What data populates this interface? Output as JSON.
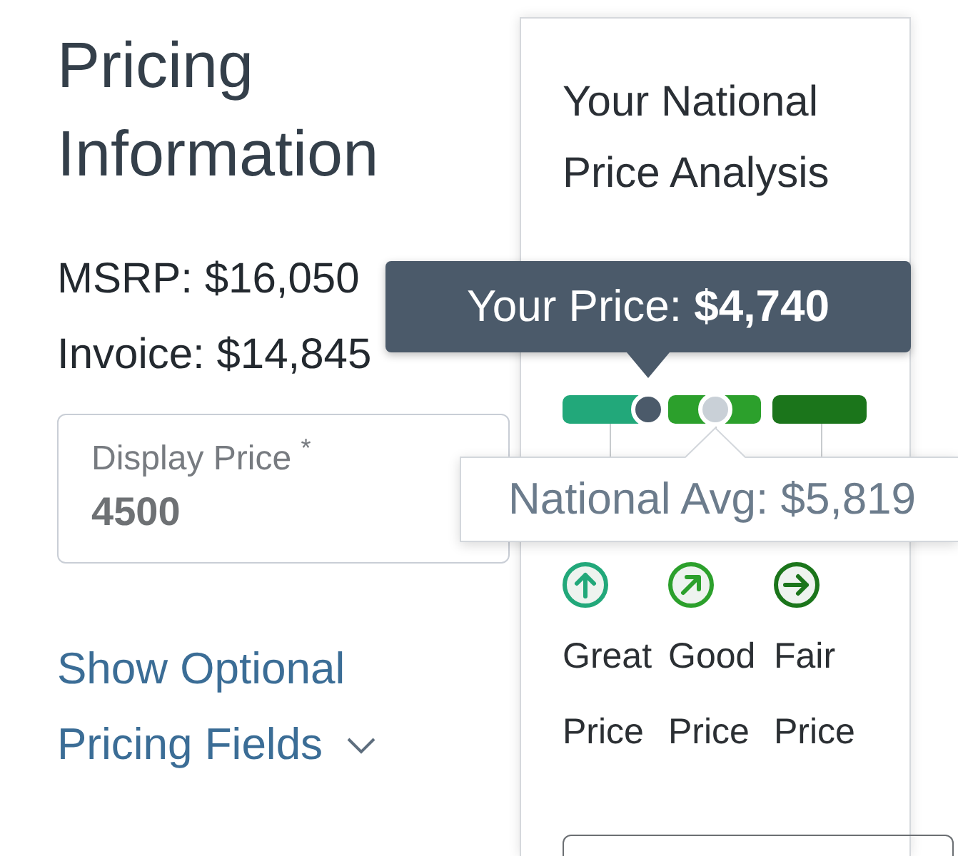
{
  "pricing": {
    "title": "Pricing Information",
    "lines": [
      "MSRP: $16,050",
      "Invoice: $14,845"
    ],
    "display_price": {
      "label": "Display Price $^{*}$",
      "value": "4500"
    },
    "optional_fields_link": {
      "label": "Show Optional Pricing Fields",
      "expanded": false
    }
  },
  "analysis": {
    "title": "Your National Price Analysis",
    "scale": {
      "markers": [
        {
          "kind": "your_price",
          "level": 0.28
        },
        {
          "kind": "national_avg",
          "level": 0.5
        }
      ]
    },
    "tooltips": [
      {
        "kind": "your_price",
        "text": "Your Price: **$4,740**"
      },
      {
        "kind": "national_avg",
        "text": "National Avg: $5,819"
      }
    ],
    "ratings": [
      {
        "kind": "up",
        "color": "#22a87a",
        "label": "Great Price"
      },
      {
        "kind": "up-right",
        "color": "#2ca02c",
        "label": "Good Price"
      },
      {
        "kind": "right",
        "color": "#1b751b",
        "label": "Fair Price"
      }
    ]
  }
}
